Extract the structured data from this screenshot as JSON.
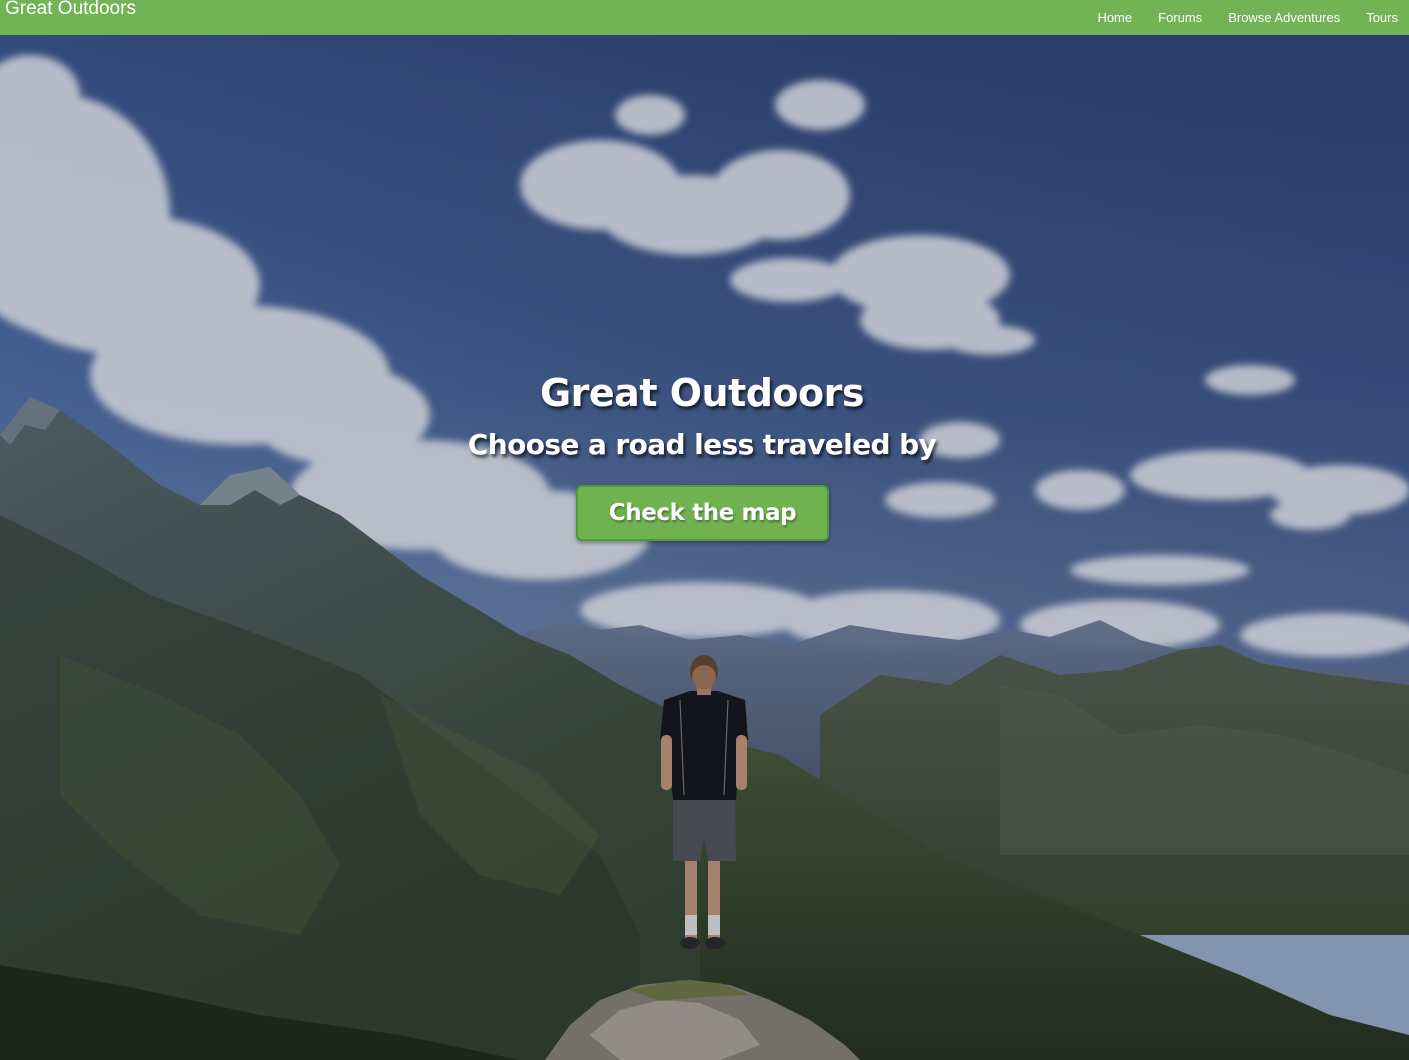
{
  "navbar": {
    "brand": "Great Outdoors",
    "links": [
      {
        "label": "Home"
      },
      {
        "label": "Forums"
      },
      {
        "label": "Browse Adventures"
      },
      {
        "label": "Tours"
      }
    ]
  },
  "hero": {
    "title": "Great Outdoors",
    "subtitle": "Choose a road less traveled by",
    "cta_label": "Check the map"
  },
  "colors": {
    "navbar": "#72b356",
    "button": "#6fb24f",
    "button_border": "#4f9a35",
    "sky_top": "#3c5a93",
    "sky_bottom": "#7d9bc4",
    "mountain": "#4a5c3a"
  }
}
